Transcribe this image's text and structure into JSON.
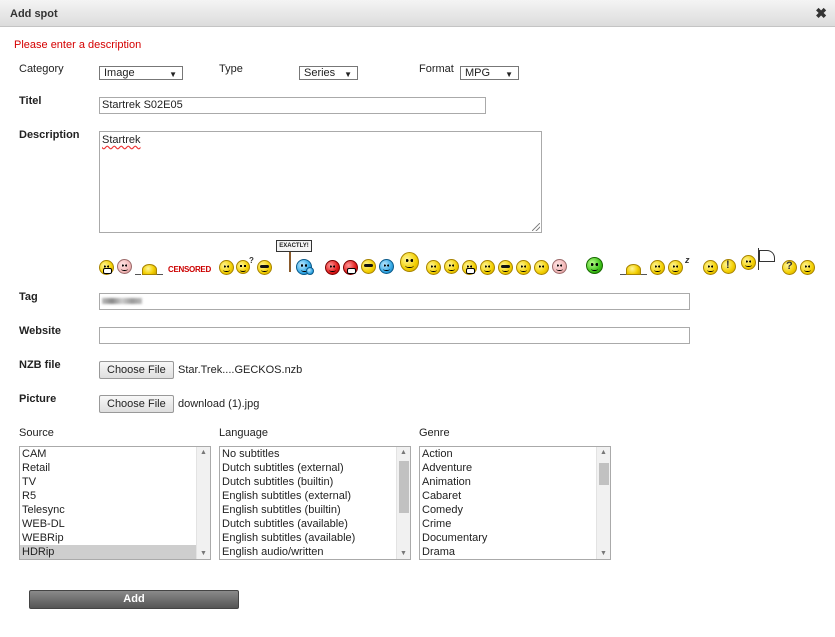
{
  "window": {
    "title": "Add spot",
    "close_glyph": "✖"
  },
  "error_message": "Please enter a description",
  "category": {
    "label": "Category",
    "value": "Image"
  },
  "type": {
    "label": "Type",
    "value": "Series"
  },
  "format": {
    "label": "Format",
    "value": "MPG"
  },
  "title_field": {
    "label": "Titel",
    "value": "Startrek S02E05"
  },
  "description": {
    "label": "Description",
    "value": "Startrek"
  },
  "smileys": {
    "censored_text": "CENSORED",
    "exactly_text": "EXACTLY!",
    "question_glyph": "?",
    "exclamation_glyph": "!",
    "zzz_text": "z"
  },
  "tag": {
    "label": "Tag"
  },
  "website": {
    "label": "Website",
    "value": ""
  },
  "nzb_file": {
    "label": "NZB file",
    "button": "Choose File",
    "filename": "Star.Trek....GECKOS.nzb"
  },
  "picture": {
    "label": "Picture",
    "button": "Choose File",
    "filename": "download (1).jpg"
  },
  "source": {
    "label": "Source",
    "options": [
      "CAM",
      "Retail",
      "TV",
      "R5",
      "Telesync",
      "WEB-DL",
      "WEBRip",
      "HDRip"
    ],
    "selected": "HDRip"
  },
  "language": {
    "label": "Language",
    "options": [
      "No subtitles",
      "Dutch subtitles (external)",
      "Dutch subtitles (builtin)",
      "English subtitles (external)",
      "English subtitles (builtin)",
      "Dutch subtitles (available)",
      "English subtitles (available)",
      "English audio/written"
    ]
  },
  "genre": {
    "label": "Genre",
    "options": [
      "Action",
      "Adventure",
      "Animation",
      "Cabaret",
      "Comedy",
      "Crime",
      "Documentary",
      "Drama"
    ]
  },
  "add_button": "Add"
}
